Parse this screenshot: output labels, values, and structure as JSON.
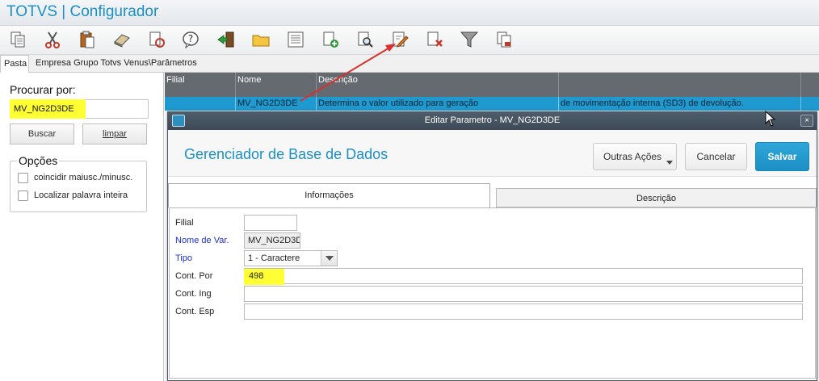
{
  "app": {
    "title": "TOTVS | Configurador"
  },
  "toolbar": {
    "icons": [
      "copy-doc-icon",
      "scissors-icon",
      "clipboard-icon",
      "eraser-icon",
      "refresh-doc-icon",
      "help-icon",
      "exit-icon",
      "folder-icon",
      "list-icon",
      "add-doc-icon",
      "preview-icon",
      "edit-doc-icon",
      "delete-doc-icon",
      "filter-icon",
      "print-doc-icon"
    ]
  },
  "tabs": {
    "pasta": "Pasta",
    "path": "Empresa Grupo Totvs Venus\\Parâmetros"
  },
  "left": {
    "procurar_label": "Procurar por:",
    "search_value": "MV_NG2D3DE",
    "buscar": "Buscar",
    "limpar": "limpar",
    "opcoes_label": "Opções",
    "opt1": "coincidir maiusc./minusc.",
    "opt2": "Localizar palavra inteira"
  },
  "grid": {
    "headers": [
      "Filial",
      "Nome",
      "Descrição",
      ""
    ],
    "row": [
      "",
      "MV_NG2D3DE",
      "Determina o valor utilizado para geração",
      "de movimentação interna (SD3) de devolução."
    ]
  },
  "dialog": {
    "title": "Editar Parametro - MV_NG2D3DE",
    "close": "×",
    "heading": "Gerenciador de Base de Dados",
    "outras": "Outras Ações",
    "cancelar": "Cancelar",
    "salvar": "Salvar",
    "tab_info": "Informações",
    "tab_desc": "Descrição",
    "fields": {
      "filial_label": "Filial",
      "filial_value": "",
      "nome_label": "Nome de Var.",
      "nome_value": "MV_NG2D3D",
      "tipo_label": "Tipo",
      "tipo_value": "1 - Caractere",
      "por_label": "Cont. Por",
      "por_value": "498",
      "ing_label": "Cont. Ing",
      "ing_value": "",
      "esp_label": "Cont. Esp",
      "esp_value": ""
    }
  },
  "colors": {
    "accent": "#1d8fc3",
    "highlight": "#ffff33",
    "grid_selected": "#1e9ad0",
    "annotation_arrow": "#d9312b"
  }
}
